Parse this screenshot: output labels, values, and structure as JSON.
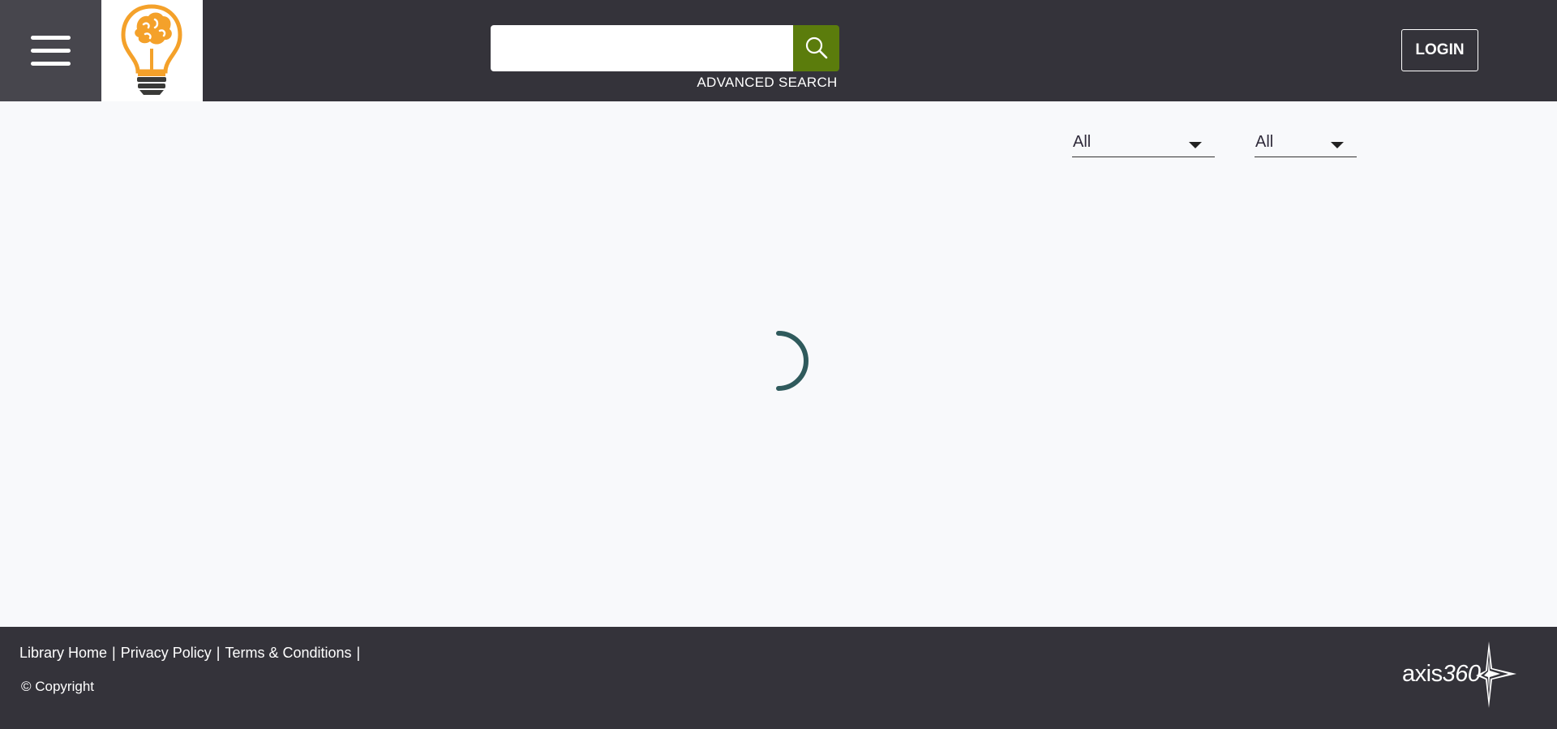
{
  "header": {
    "search": {
      "value": "",
      "placeholder": ""
    },
    "advanced_search_label": "ADVANCED SEARCH",
    "login_label": "LOGIN"
  },
  "filters": [
    {
      "selected": "All"
    },
    {
      "selected": "All"
    }
  ],
  "footer": {
    "links": [
      "Library Home",
      "Privacy Policy",
      "Terms & Conditions"
    ],
    "copyright": "© Copyright",
    "brand": {
      "word": "axis",
      "number": "360"
    }
  },
  "colors": {
    "header_bg": "#34333a",
    "menu_bg": "#47464d",
    "search_button": "#5b7c0c",
    "page_bg": "#f8f9fb",
    "spinner": "#2f5a5c",
    "logo_bulb": "#f4a12a"
  },
  "icons": {
    "menu": "hamburger-icon",
    "logo": "lightbulb-brain-logo",
    "search": "search-icon",
    "dropdown": "caret-down-icon",
    "loading": "loading-spinner-icon",
    "brand": "axis360-star-logo"
  }
}
